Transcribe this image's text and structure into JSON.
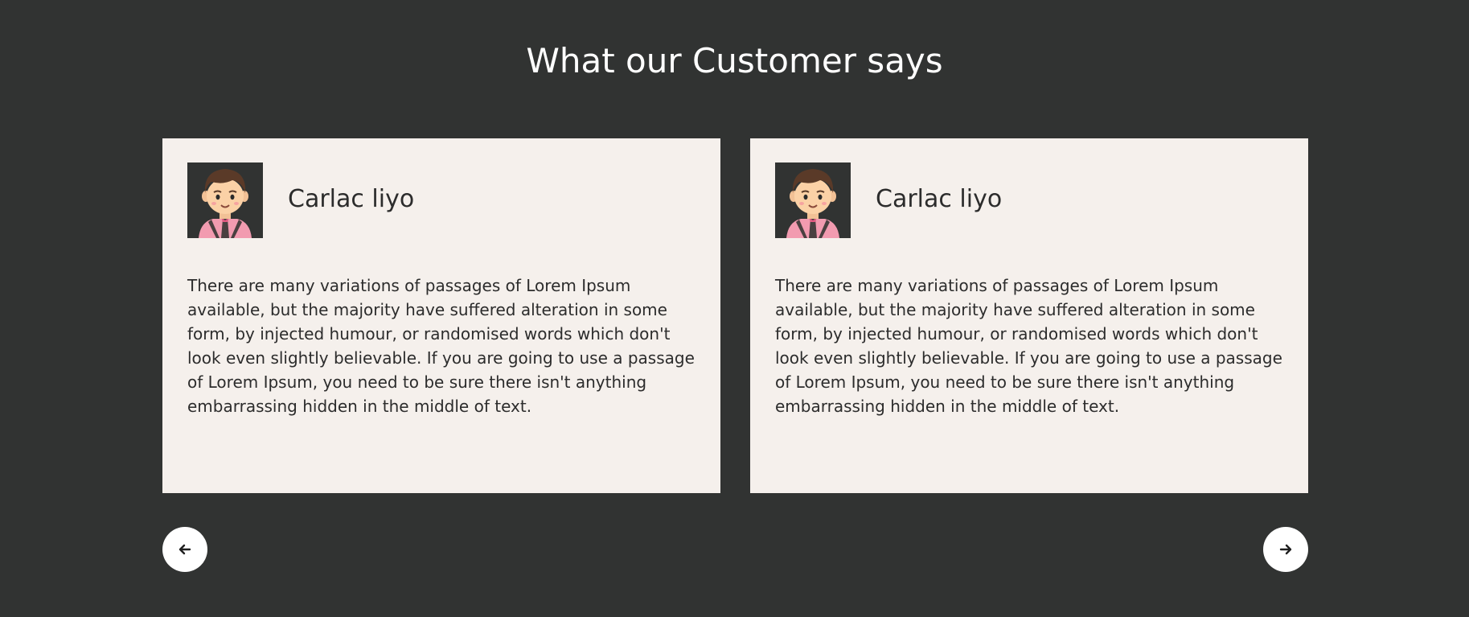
{
  "section": {
    "title": "What our Customer says"
  },
  "testimonials": [
    {
      "name": "Carlac liyo",
      "avatar_icon": "cartoon-man-avatar",
      "text": "There are many variations of passages of Lorem Ipsum available, but the majority have suffered alteration in some form, by injected humour, or randomised words which don't look even slightly believable. If you are going to use a passage of Lorem Ipsum, you need to be sure there isn't anything embarrassing hidden in the middle of text."
    },
    {
      "name": "Carlac liyo",
      "avatar_icon": "cartoon-man-avatar",
      "text": "There are many variations of passages of Lorem Ipsum available, but the majority have suffered alteration in some form, by injected humour, or randomised words which don't look even slightly believable. If you are going to use a passage of Lorem Ipsum, you need to be sure there isn't anything embarrassing hidden in the middle of text."
    }
  ],
  "carousel": {
    "prev_icon": "arrow-left-icon",
    "next_icon": "arrow-right-icon"
  },
  "colors": {
    "background": "#313332",
    "card": "#f5f0ec",
    "text": "#2c2c2c",
    "title": "#ffffff",
    "button": "#ffffff"
  }
}
